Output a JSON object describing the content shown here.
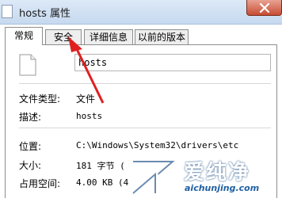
{
  "window": {
    "title": "hosts 属性"
  },
  "tabs": [
    {
      "label": "常规",
      "active": true
    },
    {
      "label": "安全",
      "active": false
    },
    {
      "label": "详细信息",
      "active": false
    },
    {
      "label": "以前的版本",
      "active": false
    }
  ],
  "general": {
    "file_name": "hosts",
    "file_type_label": "文件类型:",
    "file_type_value": "文件",
    "description_label": "描述:",
    "description_value": "hosts",
    "location_label": "位置:",
    "location_value": "C:\\Windows\\System32\\drivers\\etc",
    "size_label": "大小:",
    "size_value": "181 字节 (",
    "size_on_disk_label": "占用空间:",
    "size_on_disk_value": "4.00 KB (4"
  },
  "watermark": {
    "brand": "爱纯净",
    "url": "aichunjing.com"
  },
  "colors": {
    "arrow": "#e02020",
    "close_button": "#c74d33",
    "watermark_blue": "#1f5fa3"
  }
}
